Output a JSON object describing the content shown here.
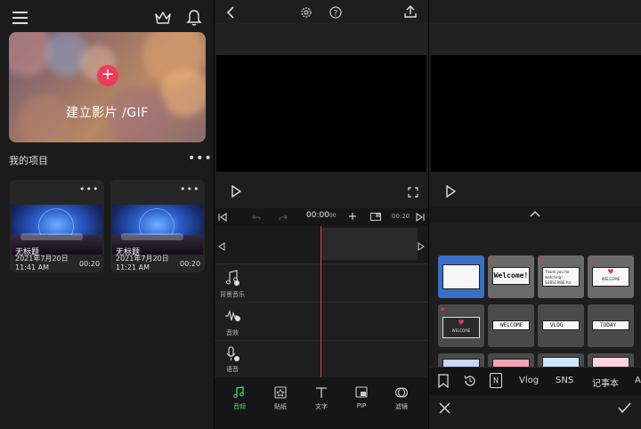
{
  "home": {
    "create_label": "建立影片 /GIF",
    "plus": "+",
    "projects_title": "我的项目",
    "more": "•••",
    "projects": [
      {
        "title": "无标题",
        "date": "2021年7月20日",
        "time": "11:41 AM",
        "duration": "00:20"
      },
      {
        "title": "无标题",
        "date": "2021年7月20日",
        "time": "11:21 AM",
        "duration": "00:20"
      }
    ]
  },
  "editor": {
    "current_time": "00:00",
    "current_frame": "00",
    "end_time": "00:20",
    "tracks": [
      {
        "label": "背景音乐",
        "icon": "music-note-icon"
      },
      {
        "label": "音效",
        "icon": "waveform-icon"
      },
      {
        "label": "语音",
        "icon": "microphone-icon"
      }
    ],
    "tools": [
      {
        "label": "音频",
        "icon": "music-icon",
        "active": true
      },
      {
        "label": "贴纸",
        "icon": "sticker-icon",
        "active": false
      },
      {
        "label": "文字",
        "icon": "text-icon",
        "active": false
      },
      {
        "label": "PIP",
        "icon": "pip-icon",
        "active": false
      },
      {
        "label": "滤镜",
        "icon": "filter-icon",
        "active": false
      }
    ]
  },
  "stickers": {
    "section_title": "新",
    "badge": "N",
    "items": [
      {
        "text": ""
      },
      {
        "text": "Welcome!"
      },
      {
        "text": "Thank you for watching! SUBSCRIBE for more!!"
      },
      {
        "text": "WELCOME"
      },
      {
        "text": "WELCOME"
      },
      {
        "text": "WELCOME"
      },
      {
        "text": "VLOG"
      },
      {
        "text": "TODAY"
      }
    ],
    "tabs": [
      "Vlog",
      "SNS",
      "记事本",
      "A"
    ]
  },
  "colors": {
    "accent": "#f23a5a",
    "active_tool": "#3ddc84",
    "playhead": "#e23b53"
  }
}
